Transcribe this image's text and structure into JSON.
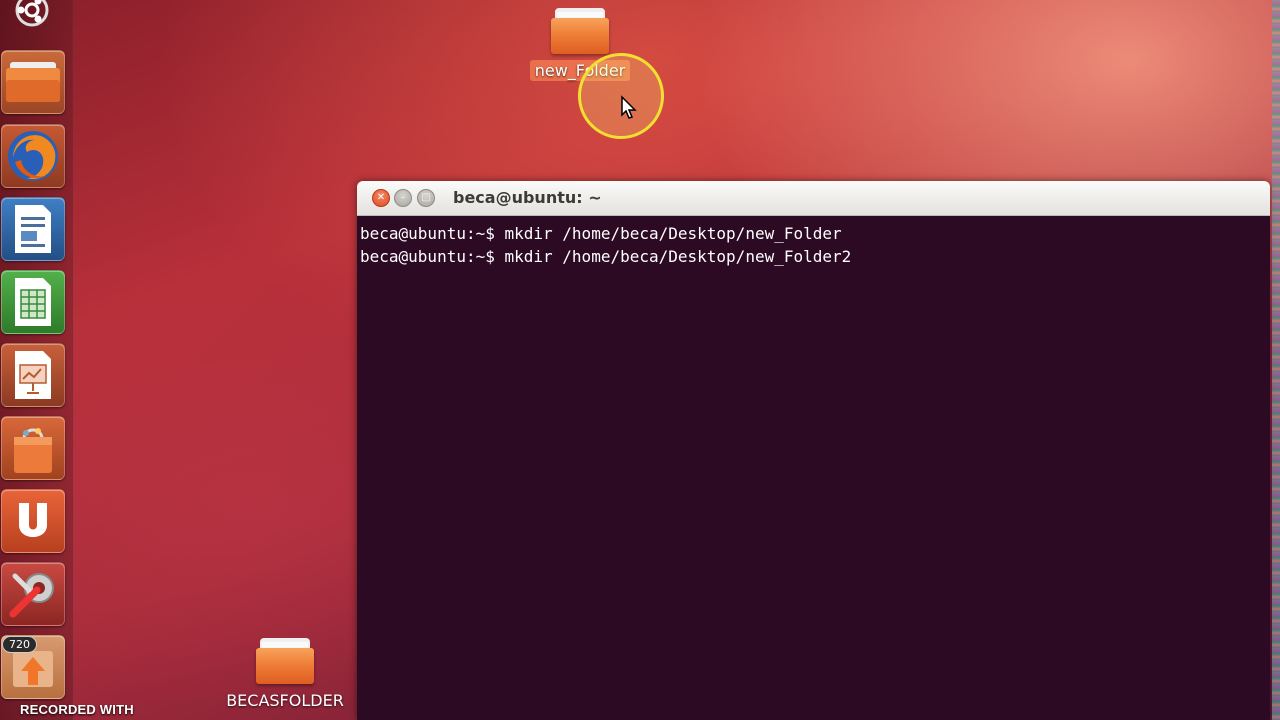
{
  "launcher": {
    "items": [
      {
        "name": "dash-home",
        "icon": "ubuntu-logo-icon"
      },
      {
        "name": "files",
        "icon": "folder-icon",
        "color": "#e9743a"
      },
      {
        "name": "firefox",
        "icon": "firefox-icon",
        "color": "#e66000"
      },
      {
        "name": "writer",
        "icon": "document-icon",
        "color": "#2d6aa8"
      },
      {
        "name": "calc",
        "icon": "spreadsheet-icon",
        "color": "#3a9a3a"
      },
      {
        "name": "impress",
        "icon": "presentation-icon",
        "color": "#c0603a"
      },
      {
        "name": "software-center",
        "icon": "shopping-bag-icon",
        "color": "#e35a20"
      },
      {
        "name": "ubuntu-one",
        "icon": "ubuntu-one-icon",
        "color": "#e4572e"
      },
      {
        "name": "system-settings",
        "icon": "tools-icon",
        "color": "#c33"
      },
      {
        "name": "update-manager",
        "icon": "update-arrow-icon",
        "color": "#e8904a"
      }
    ],
    "badge": "720"
  },
  "watermark": "RECORDED WITH",
  "desktop": {
    "icons": [
      {
        "label": "new_Folder",
        "selected": true
      },
      {
        "label": "BECASFOLDER",
        "selected": false
      }
    ]
  },
  "terminal": {
    "title": "beca@ubuntu: ~",
    "lines": [
      "beca@ubuntu:~$ mkdir /home/beca/Desktop/new_Folder",
      "beca@ubuntu:~$ mkdir /home/beca/Desktop/new_Folder2"
    ],
    "colors": {
      "background": "#2c0a24",
      "text": "#ffffff"
    }
  }
}
